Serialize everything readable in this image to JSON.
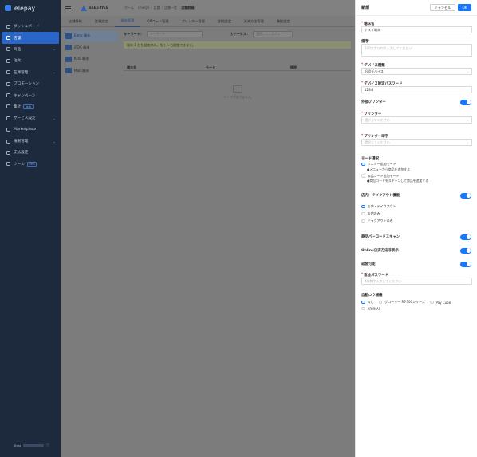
{
  "sidebar": {
    "logo": "elepay",
    "items": [
      {
        "label": "ダッシュボード",
        "chevron": false,
        "badge": ""
      },
      {
        "label": "店舗",
        "chevron": false,
        "badge": "",
        "active": true
      },
      {
        "label": "商品",
        "chevron": true,
        "badge": ""
      },
      {
        "label": "注文",
        "chevron": false,
        "badge": ""
      },
      {
        "label": "在庫管理",
        "chevron": true,
        "badge": ""
      },
      {
        "label": "プロモーション",
        "chevron": false,
        "badge": ""
      },
      {
        "label": "キャンペーン",
        "chevron": false,
        "badge": ""
      },
      {
        "label": "集計",
        "chevron": false,
        "badge": "Beta"
      },
      {
        "label": "サービス設定",
        "chevron": true,
        "badge": ""
      },
      {
        "label": "Marketplace",
        "chevron": false,
        "badge": ""
      },
      {
        "label": "権限管理",
        "chevron": true,
        "badge": ""
      },
      {
        "label": "支払設定",
        "chevron": false,
        "badge": ""
      },
      {
        "label": "ツール",
        "chevron": false,
        "badge": "Beta"
      }
    ],
    "footer_label": "Beta"
  },
  "header": {
    "brand": "ELESTYLE",
    "breadcrumbs": [
      "ホーム",
      "OneQR",
      "店舗",
      "店舗一覧",
      "店舗詳細"
    ]
  },
  "tabs": [
    "店舗情報",
    "営業設定",
    "端末管理",
    "QRコード管理",
    "プリンター管理",
    "詳細設定",
    "決済方法管理",
    "機能設定"
  ],
  "active_tab": "端末管理",
  "devices": [
    "Elmo 端末",
    "iPOS 端末",
    "KDS 端末",
    "Mall 端末"
  ],
  "filter": {
    "keyword_label": "キーワード：",
    "keyword_placeholder": "キーワード",
    "status_label": "ステータス：",
    "status_placeholder": "選択してください"
  },
  "notice": "端末 1 台を設定済み。残り 1 台設定できます。",
  "table": {
    "headers": [
      "端末名",
      "モード",
      "備考"
    ],
    "empty_text": "データがありません"
  },
  "drawer": {
    "title": "新規",
    "cancel": "キャンセル",
    "ok": "OK",
    "name_label": "端末名",
    "name_value": "テスト端末",
    "note_label": "備考",
    "note_placeholder": "100文字以内で入力してください",
    "device_type_label": "デバイス種類",
    "device_type_value": "汎用デバイス",
    "device_pw_label": "デバイス設定パスワード",
    "device_pw_value": "1234",
    "ext_printer_label": "外部プリンター",
    "printer_label": "プリンター",
    "printer_placeholder": "選択してください",
    "printer_print_label": "プリンター印字",
    "printer_print_placeholder": "選択してください",
    "mode_label": "モード選択",
    "mode_opt1": "メニュー追加モード",
    "mode_opt1_sub": "●メニューから商品を追加する",
    "mode_opt2": "商品コード追加モード",
    "mode_opt2_sub": "●商品コードをスキャンして商品を追加する",
    "eatin_label": "店内・テイクアウト機能",
    "eatin_opt1": "店内・テイクアウト",
    "eatin_opt2": "店内のみ",
    "eatin_opt3": "テイクアウトのみ",
    "barcode_label": "商品バーコードスキャン",
    "online_label": "Online決済方法非表示",
    "refund_label": "返金可能",
    "refund_pw_label": "返金パスワード",
    "refund_pw_placeholder": "4桁数字入力してください",
    "cash_label": "自動つり銭機",
    "cash_opts": [
      "なし",
      "グローリー RT-300シリーズ",
      "Pay Cube",
      "ARUNAS"
    ]
  },
  "colors": {
    "primary": "#1677ff",
    "sidebar_bg": "#1d2a3e",
    "active_nav": "#2a65c8"
  }
}
